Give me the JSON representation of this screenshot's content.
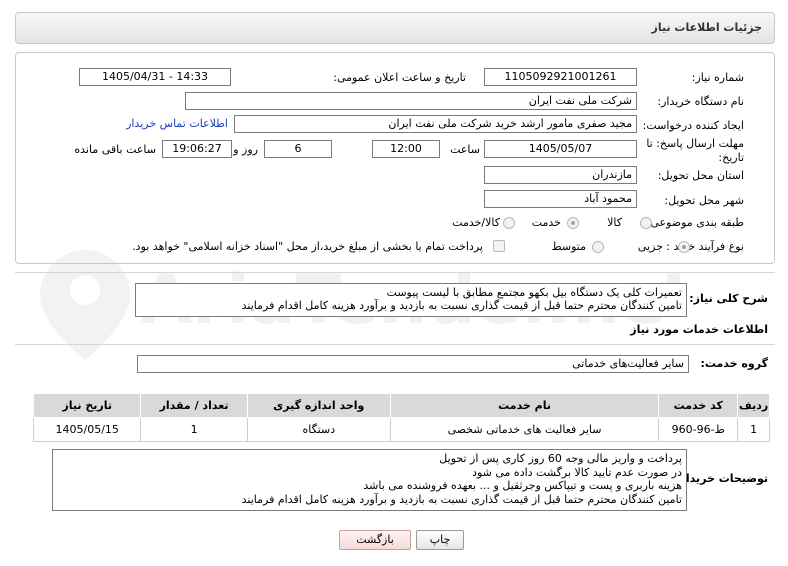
{
  "header": {
    "title": "جزئیات اطلاعات نیاز"
  },
  "form": {
    "need_number_label": "شماره نیاز:",
    "need_number": "1105092921001261",
    "announce_label": "تاریخ و ساعت اعلان عمومی:",
    "announce_value": "1405/04/31 - 14:33",
    "buyer_org_label": "نام دستگاه خریدار:",
    "buyer_org": "شرکت ملی نفت ایران",
    "requester_label": "ایجاد کننده درخواست:",
    "requester": "مجید صفری مامور ارشد خرید شرکت ملی نفت ایران",
    "contact_link": "اطلاعات تماس خریدار",
    "deadline_label_1": "مهلت ارسال پاسخ: تا",
    "deadline_label_2": "تاریخ:",
    "deadline_date": "1405/05/07",
    "time_label": "ساعت",
    "deadline_time": "12:00",
    "days_value": "6",
    "days_label": "روز و",
    "remaining_time": "19:06:27",
    "remaining_label": "ساعت باقی مانده",
    "province_label": "استان محل تحویل:",
    "province": "مازندران",
    "city_label": "شهر محل تحویل:",
    "city": "محمود آباد",
    "category_label": "طبقه بندی موضوعی:",
    "category_options": [
      "کالا",
      "خدمت",
      "کالا/خدمت"
    ],
    "category_selected": "خدمت",
    "process_label": "نوع فرآیند خرید :",
    "process_options": [
      "جزیی",
      "متوسط"
    ],
    "process_selected": "جزیی",
    "treasury_note": "پرداخت تمام یا بخشی از مبلغ خرید،از محل \"اسناد خزانه اسلامی\" خواهد بود."
  },
  "description": {
    "label": "شرح کلی نیاز:",
    "lines": [
      "تعمیرات کلی یک دستگاه بیل بکهو مجتمع مطابق با لیست پیوست",
      "تامین کنندگان محترم حتما قبل از قیمت گذاری نسبت به بازدید و برآورد هزینه کامل اقدام فرمایند"
    ]
  },
  "services_section": {
    "title": "اطلاعات خدمات مورد نیاز",
    "group_label": "گروه خدمت:",
    "group_value": "سایر فعالیت‌های خدماتی"
  },
  "table": {
    "headers": [
      "ردیف",
      "کد خدمت",
      "نام خدمت",
      "واحد اندازه گیری",
      "تعداد / مقدار",
      "تاریخ نیاز"
    ],
    "rows": [
      [
        "1",
        "ط-96-960",
        "سایر فعالیت های خدماتی شخصی",
        "دستگاه",
        "1",
        "1405/05/15"
      ]
    ]
  },
  "buyer_notes": {
    "label": "توضیحات خریدار:",
    "lines": [
      "پرداخت و واریز مالی وجه 60 روز کاری پس از تحویل",
      "در صورت عدم تایید کالا برگشت داده می شود",
      "هزینه باربری و پست و تیپاکس وجرثقیل و ... بعهده فروشنده می باشد",
      "تامین کنندگان محترم حتما قبل از قیمت گذاری نسبت به بازدید و برآورد هزینه کامل اقدام فرمایند"
    ]
  },
  "buttons": {
    "print": "چاپ",
    "back": "بازگشت"
  },
  "watermark": {
    "text": "AriaTender.neT"
  },
  "colors": {
    "link": "#1a3fb4",
    "header_bg": "#e9e9e9",
    "table_header_bg": "#d9d9d9",
    "back_button_bg": "#f6dada"
  }
}
